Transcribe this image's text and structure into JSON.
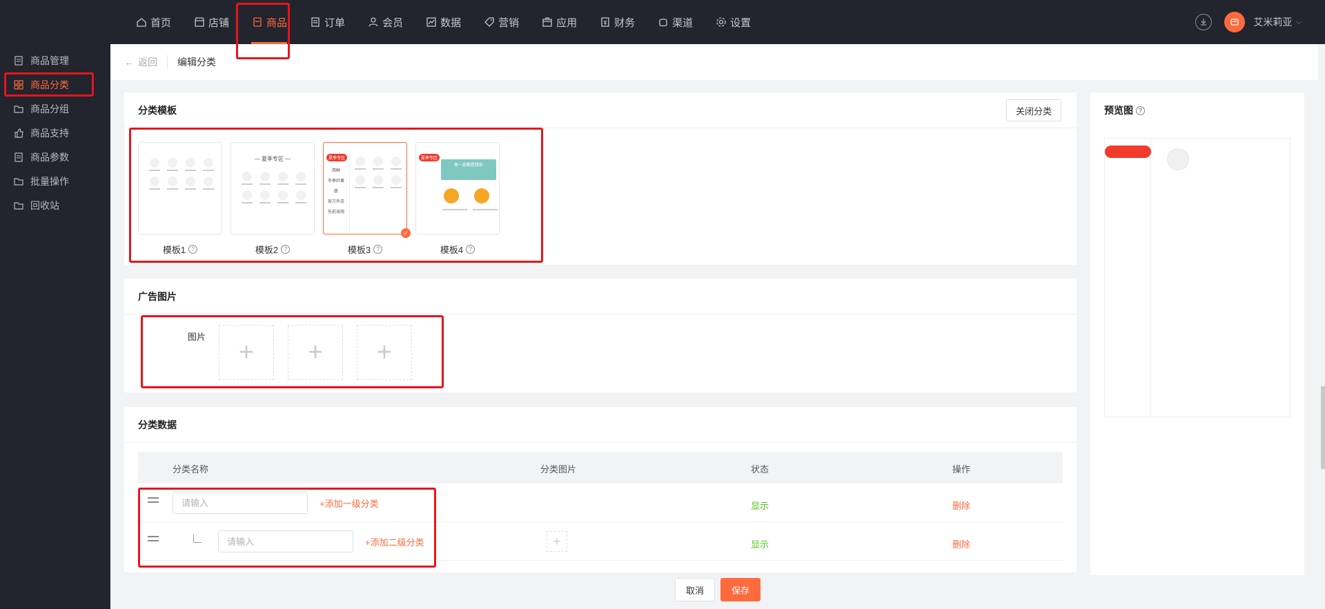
{
  "topnav": {
    "items": [
      {
        "label": "首页",
        "icon": "home-icon"
      },
      {
        "label": "店铺",
        "icon": "store-icon"
      },
      {
        "label": "商品",
        "icon": "goods-icon",
        "active": true
      },
      {
        "label": "订单",
        "icon": "order-icon"
      },
      {
        "label": "会员",
        "icon": "member-icon"
      },
      {
        "label": "数据",
        "icon": "chart-icon"
      },
      {
        "label": "营销",
        "icon": "tag-icon"
      },
      {
        "label": "应用",
        "icon": "app-icon"
      },
      {
        "label": "财务",
        "icon": "finance-icon"
      },
      {
        "label": "渠道",
        "icon": "channel-icon"
      },
      {
        "label": "设置",
        "icon": "gear-icon"
      }
    ],
    "username": "艾米莉亚",
    "accent": "#ff6a3d"
  },
  "sidebar": {
    "items": [
      {
        "label": "商品管理"
      },
      {
        "label": "商品分类",
        "active": true
      },
      {
        "label": "商品分组"
      },
      {
        "label": "商品支持"
      },
      {
        "label": "商品参数"
      },
      {
        "label": "批量操作"
      },
      {
        "label": "回收站"
      }
    ]
  },
  "breadcrumb": {
    "back": "返回",
    "title": "编辑分类"
  },
  "template_section": {
    "title": "分类模板",
    "close_button": "关闭分类",
    "templates": [
      {
        "label": "模板1"
      },
      {
        "label": "模板2",
        "banner": "— 夏季专区 —"
      },
      {
        "label": "模板3",
        "selected": true,
        "tag": "夏季专区",
        "side": [
          "西鲜",
          "冬季好果蔬",
          "官方外店",
          "先前海淘"
        ]
      },
      {
        "label": "模板4",
        "tag": "夏季专区",
        "banner": "每一款都是精彩"
      }
    ]
  },
  "ad_section": {
    "title": "广告图片",
    "field_label": "图片"
  },
  "data_section": {
    "title": "分类数据",
    "columns": [
      "分类名称",
      "分类图片",
      "状态",
      "操作"
    ],
    "rows": [
      {
        "placeholder": "请输入",
        "add_label": "+添加一级分类",
        "status": "显示",
        "action": "删除"
      },
      {
        "placeholder": "请输入",
        "add_label": "+添加二级分类",
        "status": "显示",
        "action": "删除"
      }
    ]
  },
  "preview": {
    "title": "预览图"
  },
  "footer": {
    "cancel": "取消",
    "save": "保存"
  }
}
